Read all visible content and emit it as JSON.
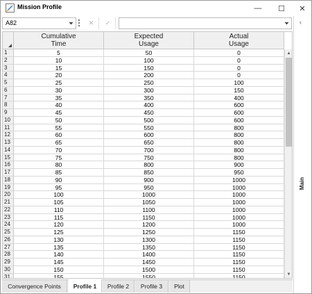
{
  "window": {
    "title": "Mission Profile",
    "minimize": "—",
    "maximize": "☐",
    "close": "✕"
  },
  "toolbar": {
    "cell_ref": "A82",
    "cancel_label": "✕",
    "ok_label": "✓",
    "formula_value": ""
  },
  "grid": {
    "columns": [
      {
        "line1": "Cumulative",
        "line2": "Time"
      },
      {
        "line1": "Expected",
        "line2": "Usage"
      },
      {
        "line1": "Actual",
        "line2": "Usage"
      }
    ],
    "rows": [
      [
        "1",
        "5",
        "50",
        "0"
      ],
      [
        "2",
        "10",
        "100",
        "0"
      ],
      [
        "3",
        "15",
        "150",
        "0"
      ],
      [
        "4",
        "20",
        "200",
        "0"
      ],
      [
        "5",
        "25",
        "250",
        "100"
      ],
      [
        "6",
        "30",
        "300",
        "150"
      ],
      [
        "7",
        "35",
        "350",
        "400"
      ],
      [
        "8",
        "40",
        "400",
        "600"
      ],
      [
        "9",
        "45",
        "450",
        "600"
      ],
      [
        "10",
        "50",
        "500",
        "600"
      ],
      [
        "11",
        "55",
        "550",
        "800"
      ],
      [
        "12",
        "60",
        "600",
        "800"
      ],
      [
        "13",
        "65",
        "650",
        "800"
      ],
      [
        "14",
        "70",
        "700",
        "800"
      ],
      [
        "15",
        "75",
        "750",
        "800"
      ],
      [
        "16",
        "80",
        "800",
        "900"
      ],
      [
        "17",
        "85",
        "850",
        "950"
      ],
      [
        "18",
        "90",
        "900",
        "1000"
      ],
      [
        "19",
        "95",
        "950",
        "1000"
      ],
      [
        "20",
        "100",
        "1000",
        "1000"
      ],
      [
        "21",
        "105",
        "1050",
        "1000"
      ],
      [
        "22",
        "110",
        "1100",
        "1000"
      ],
      [
        "23",
        "115",
        "1150",
        "1000"
      ],
      [
        "24",
        "120",
        "1200",
        "1000"
      ],
      [
        "25",
        "125",
        "1250",
        "1150"
      ],
      [
        "26",
        "130",
        "1300",
        "1150"
      ],
      [
        "27",
        "135",
        "1350",
        "1150"
      ],
      [
        "28",
        "140",
        "1400",
        "1150"
      ],
      [
        "29",
        "145",
        "1450",
        "1150"
      ],
      [
        "30",
        "150",
        "1500",
        "1150"
      ],
      [
        "31",
        "155",
        "1550",
        "1150"
      ]
    ]
  },
  "tabs": [
    {
      "label": "Convergence Points",
      "active": false
    },
    {
      "label": "Profile 1",
      "active": true
    },
    {
      "label": "Profile 2",
      "active": false
    },
    {
      "label": "Profile 3",
      "active": false
    },
    {
      "label": "Plot",
      "active": false
    }
  ],
  "side_panel": {
    "label": "Main",
    "collapse_arrow": "‹"
  },
  "colors": {
    "header_bg": "#f0f0f0",
    "grid_line": "#d8d8d8",
    "scroll_thumb": "#c2c2c2"
  },
  "icons": [
    "app-icon",
    "dropdown-arrow-icon",
    "grip-icon",
    "scroll-up-icon",
    "scroll-down-icon",
    "collapse-arrow-icon"
  ]
}
